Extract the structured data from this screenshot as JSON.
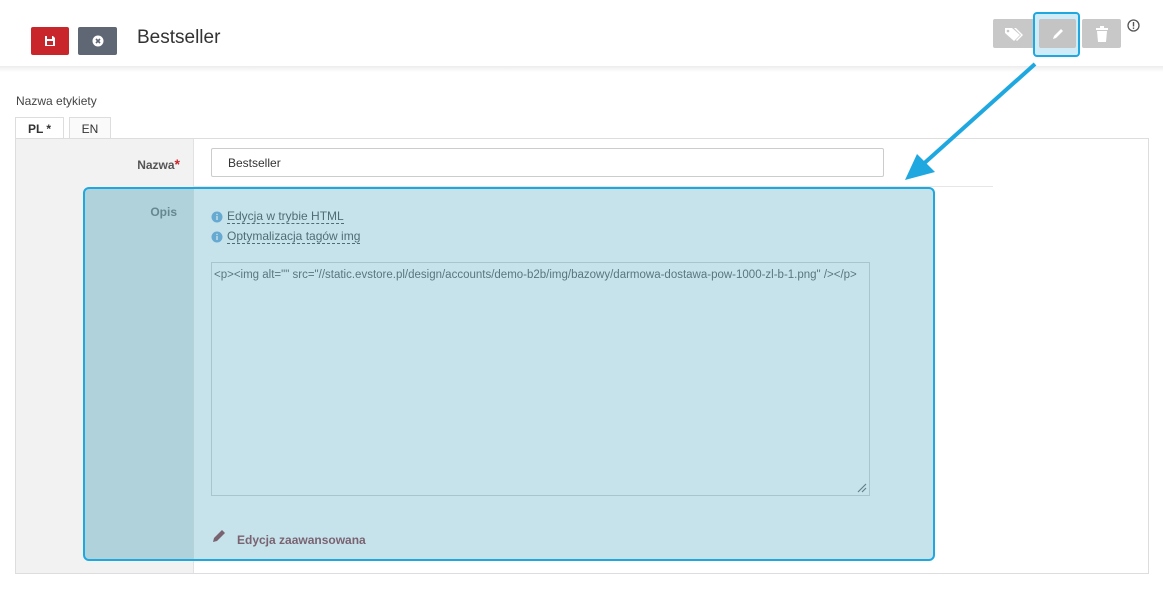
{
  "header": {
    "title": "Bestseller",
    "save_icon": "save-icon",
    "cancel_icon": "close-icon",
    "actions": [
      "tag-icon",
      "pencil-icon",
      "trash-icon",
      "info-icon"
    ]
  },
  "form": {
    "section_label": "Nazwa etykiety",
    "tabs": [
      {
        "label": "PL *",
        "active": true
      },
      {
        "label": "EN",
        "active": false
      }
    ],
    "name_label": "Nazwa",
    "name_required": "*",
    "name_value": "Bestseller",
    "desc_label": "Opis",
    "links": [
      {
        "label": "Edycja w trybie HTML",
        "icon": "info-circle-icon"
      },
      {
        "label": "Optymalizacja tagów img",
        "icon": "info-circle-icon"
      }
    ],
    "html_code": "<p><img alt=\"\" src=\"//static.evstore.pl/design/accounts/demo-b2b/img/bazowy/darmowa-dostawa-pow-1000-zl-b-1.png\" /></p>",
    "advanced_edit_label": "Edycja zaawansowana"
  },
  "colors": {
    "save": "#c9262c",
    "cancel": "#5e6773",
    "highlight": "#1fa8e0",
    "advanced_link": "#7a2530"
  }
}
